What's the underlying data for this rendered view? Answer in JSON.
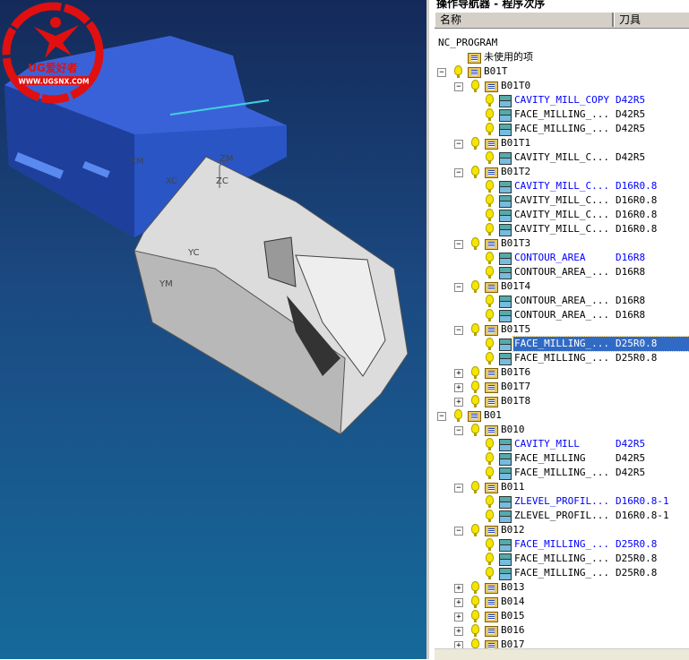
{
  "viewport": {
    "axis_labels": [
      "XM",
      "XC",
      "ZM",
      "ZC",
      "YM",
      "YC"
    ],
    "logo": {
      "brand": "UG爱好者",
      "url": "WWW.UGSNX.COM"
    }
  },
  "navigator": {
    "title": "操作导航器 - 程序次序",
    "columns": {
      "name": "名称",
      "tool": "刀具"
    },
    "rows": [
      {
        "depth": 0,
        "kind": "root",
        "name": "NC_PROGRAM"
      },
      {
        "depth": 1,
        "kind": "group",
        "name": "未使用的项",
        "nobulb": true
      },
      {
        "depth": 1,
        "kind": "group",
        "name": "B01T",
        "expander": "-"
      },
      {
        "depth": 2,
        "kind": "group",
        "name": "B01T0",
        "expander": "-"
      },
      {
        "depth": 3,
        "kind": "op",
        "name": "CAVITY_MILL_COPY",
        "tool": "D42R5",
        "blue": true
      },
      {
        "depth": 3,
        "kind": "op",
        "name": "FACE_MILLING_...",
        "tool": "D42R5"
      },
      {
        "depth": 3,
        "kind": "op",
        "name": "FACE_MILLING_...",
        "tool": "D42R5"
      },
      {
        "depth": 2,
        "kind": "group",
        "name": "B01T1",
        "expander": "-"
      },
      {
        "depth": 3,
        "kind": "op",
        "name": "CAVITY_MILL_C...",
        "tool": "D42R5"
      },
      {
        "depth": 2,
        "kind": "group",
        "name": "B01T2",
        "expander": "-"
      },
      {
        "depth": 3,
        "kind": "op",
        "name": "CAVITY_MILL_C...",
        "tool": "D16R0.8",
        "blue": true
      },
      {
        "depth": 3,
        "kind": "op",
        "name": "CAVITY_MILL_C...",
        "tool": "D16R0.8"
      },
      {
        "depth": 3,
        "kind": "op",
        "name": "CAVITY_MILL_C...",
        "tool": "D16R0.8"
      },
      {
        "depth": 3,
        "kind": "op",
        "name": "CAVITY_MILL_C...",
        "tool": "D16R0.8"
      },
      {
        "depth": 2,
        "kind": "group",
        "name": "B01T3",
        "expander": "-"
      },
      {
        "depth": 3,
        "kind": "op",
        "name": "CONTOUR_AREA",
        "tool": "D16R8",
        "blue": true
      },
      {
        "depth": 3,
        "kind": "op",
        "name": "CONTOUR_AREA_...",
        "tool": "D16R8"
      },
      {
        "depth": 2,
        "kind": "group",
        "name": "B01T4",
        "expander": "-"
      },
      {
        "depth": 3,
        "kind": "op",
        "name": "CONTOUR_AREA_...",
        "tool": "D16R8"
      },
      {
        "depth": 3,
        "kind": "op",
        "name": "CONTOUR_AREA_...",
        "tool": "D16R8"
      },
      {
        "depth": 2,
        "kind": "group",
        "name": "B01T5",
        "expander": "-"
      },
      {
        "depth": 3,
        "kind": "op",
        "name": "FACE_MILLING_...",
        "tool": "D25R0.8",
        "selected": true
      },
      {
        "depth": 3,
        "kind": "op",
        "name": "FACE_MILLING_...",
        "tool": "D25R0.8"
      },
      {
        "depth": 2,
        "kind": "group",
        "name": "B01T6",
        "expander": "+"
      },
      {
        "depth": 2,
        "kind": "group",
        "name": "B01T7",
        "expander": "+"
      },
      {
        "depth": 2,
        "kind": "group",
        "name": "B01T8",
        "expander": "+"
      },
      {
        "depth": 1,
        "kind": "group",
        "name": "B01",
        "expander": "-"
      },
      {
        "depth": 2,
        "kind": "group",
        "name": "B010",
        "expander": "-"
      },
      {
        "depth": 3,
        "kind": "op",
        "name": "CAVITY_MILL",
        "tool": "D42R5",
        "blue": true
      },
      {
        "depth": 3,
        "kind": "op",
        "name": "FACE_MILLING",
        "tool": "D42R5"
      },
      {
        "depth": 3,
        "kind": "op",
        "name": "FACE_MILLING_...",
        "tool": "D42R5"
      },
      {
        "depth": 2,
        "kind": "group",
        "name": "B011",
        "expander": "-"
      },
      {
        "depth": 3,
        "kind": "op",
        "name": "ZLEVEL_PROFIL...",
        "tool": "D16R0.8-1",
        "blue": true
      },
      {
        "depth": 3,
        "kind": "op",
        "name": "ZLEVEL_PROFIL...",
        "tool": "D16R0.8-1"
      },
      {
        "depth": 2,
        "kind": "group",
        "name": "B012",
        "expander": "-"
      },
      {
        "depth": 3,
        "kind": "op",
        "name": "FACE_MILLING_...",
        "tool": "D25R0.8",
        "blue": true
      },
      {
        "depth": 3,
        "kind": "op",
        "name": "FACE_MILLING_...",
        "tool": "D25R0.8"
      },
      {
        "depth": 3,
        "kind": "op",
        "name": "FACE_MILLING_...",
        "tool": "D25R0.8"
      },
      {
        "depth": 2,
        "kind": "group",
        "name": "B013",
        "expander": "+"
      },
      {
        "depth": 2,
        "kind": "group",
        "name": "B014",
        "expander": "+"
      },
      {
        "depth": 2,
        "kind": "group",
        "name": "B015",
        "expander": "+"
      },
      {
        "depth": 2,
        "kind": "group",
        "name": "B016",
        "expander": "+"
      },
      {
        "depth": 2,
        "kind": "group",
        "name": "B017",
        "expander": "+"
      }
    ]
  },
  "colors": {
    "selection": "#316ac5",
    "active_op": "#0000ff",
    "viewport_top": "#142a5a",
    "viewport_bottom": "#156a9a",
    "logo": "#e01010"
  }
}
